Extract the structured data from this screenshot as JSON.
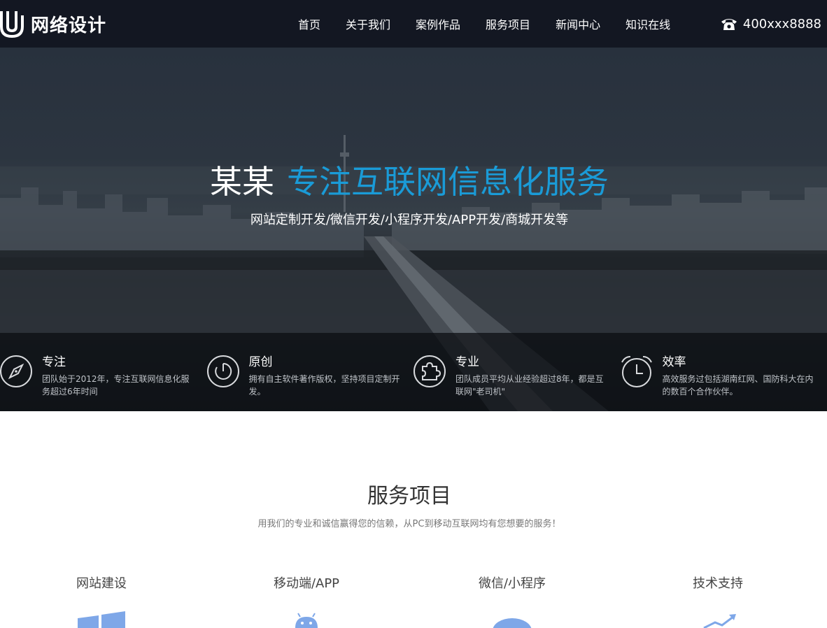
{
  "header": {
    "logo_text": "网络设计",
    "nav": [
      "首页",
      "关于我们",
      "案例作品",
      "服务项目",
      "新闻中心",
      "知识在线"
    ],
    "phone": "400xxx8888"
  },
  "hero": {
    "title_lead": "某某",
    "title_accent": "专注互联网信息化服务",
    "subtitle": "网站定制开发/微信开发/小程序开发/APP开发/商城开发等"
  },
  "features": [
    {
      "icon": "compass-icon",
      "title": "专注",
      "desc": "团队始于2012年，专注互联网信息化服务超过6年时间"
    },
    {
      "icon": "original-icon",
      "title": "原创",
      "desc": "拥有自主软件著作版权，坚持项目定制开发。"
    },
    {
      "icon": "puzzle-icon",
      "title": "专业",
      "desc": "团队成员平均从业经验超过8年，都是互联网\"老司机\""
    },
    {
      "icon": "alarm-clock-icon",
      "title": "效率",
      "desc": "高效服务过包括湖南红网、国防科大在内的数百个合作伙伴。"
    }
  ],
  "services": {
    "title": "服务项目",
    "subtitle": "用我们的专业和诚信赢得您的信赖，从PC到移动互联网均有您想要的服务！",
    "items": [
      {
        "label": "网站建设",
        "icon": "windows-icon"
      },
      {
        "label": "移动端/APP",
        "icon": "android-icon"
      },
      {
        "label": "微信/小程序",
        "icon": "wechat-icon"
      },
      {
        "label": "技术支持",
        "icon": "growth-arrow-icon"
      }
    ]
  },
  "colors": {
    "header_bg": "#131722",
    "accent": "#1a9bd7",
    "service_icon": "#7ea7e8"
  }
}
